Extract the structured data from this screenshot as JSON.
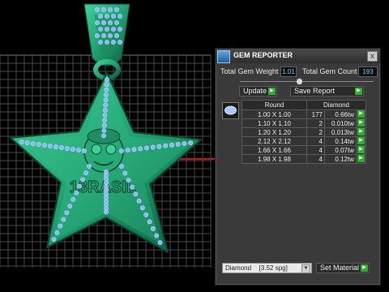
{
  "panel": {
    "title": "GEM REPORTER",
    "close": "x",
    "total_weight_label": "Total Gem Weight",
    "total_weight_value": "1.01",
    "total_count_label": "Total Gem Count",
    "total_count_value": "193",
    "update_label": "Update",
    "save_report_label": "Save Report",
    "table": {
      "headers": [
        "Round",
        "Diamond"
      ],
      "rows": [
        {
          "size": "1.00 X 1.00",
          "count": "177",
          "weight": "0.66tw"
        },
        {
          "size": "1.10 X 1.10",
          "count": "2",
          "weight": "0.010tw"
        },
        {
          "size": "1.20 X 1.20",
          "count": "2",
          "weight": "0.013tw"
        },
        {
          "size": "2.12 X 2.12",
          "count": "4",
          "weight": "0.14tw"
        },
        {
          "size": "1.66 X 1.66",
          "count": "4",
          "weight": "0.07tw"
        },
        {
          "size": "1.98 X 1.98",
          "count": "4",
          "weight": "0.12tw"
        }
      ]
    },
    "material_value": "Diamond",
    "material_sg": "[3.52 spg]",
    "set_material_label": "Set Material"
  },
  "model": {
    "engraving": "13RASIL"
  },
  "icons": {
    "go_arrow": "▶",
    "dropdown": "▼"
  },
  "colors": {
    "metal": "#2aa57a",
    "gem": "#8ab4ff",
    "grid": "#4a4a4a",
    "value_text": "#5fd3ff",
    "go_button": "#2db02d"
  }
}
